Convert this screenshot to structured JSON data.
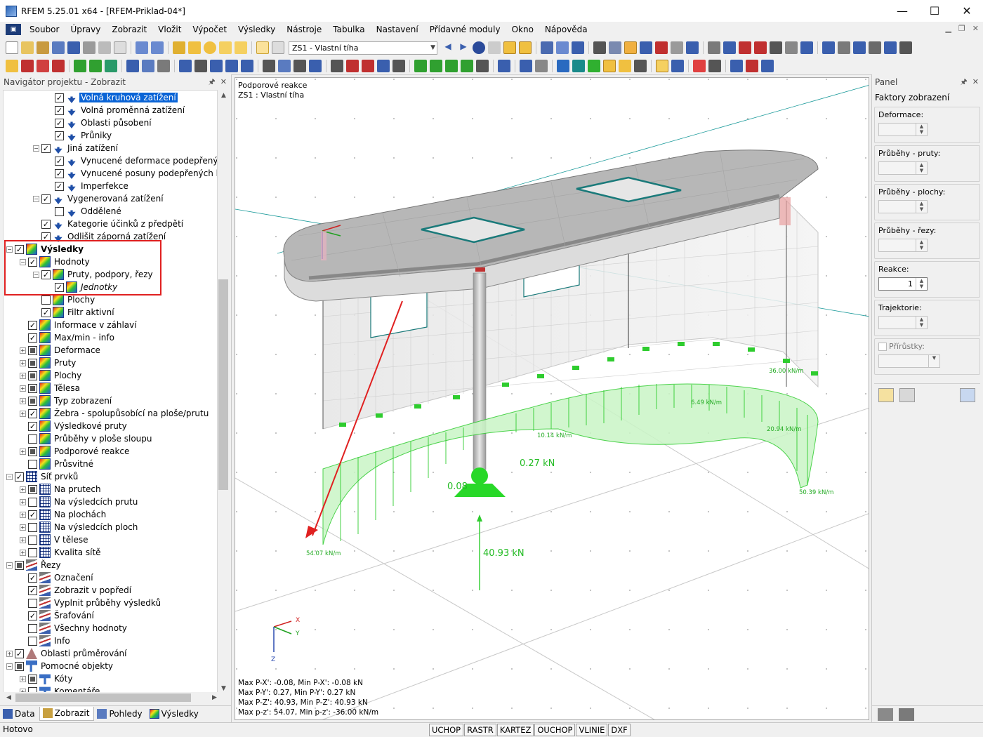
{
  "window": {
    "title": "RFEM 5.25.01 x64 - [RFEM-Priklad-04*]",
    "minimize": "—",
    "maximize": "☐",
    "close": "✕"
  },
  "menu": {
    "items": [
      "Soubor",
      "Úpravy",
      "Zobrazit",
      "Vložit",
      "Výpočet",
      "Výsledky",
      "Nástroje",
      "Tabulka",
      "Nastavení",
      "Přídavné moduly",
      "Okno",
      "Nápověda"
    ]
  },
  "toolbar": {
    "load_case": "ZS1 - Vlastní tíha"
  },
  "navigator": {
    "title": "Navigátor projektu - Zobrazit",
    "tree": [
      {
        "label": "Volná kruhová zatížení",
        "checked": true,
        "icon": "load",
        "selected": true
      },
      {
        "label": "Volná proměnná zatížení",
        "checked": true,
        "icon": "load"
      },
      {
        "label": "Oblasti působení",
        "checked": true,
        "icon": "load"
      },
      {
        "label": "Průniky",
        "checked": true,
        "icon": "load"
      },
      {
        "label": "Jiná zatížení",
        "checked": true,
        "icon": "load"
      },
      {
        "label": "Vynucené deformace podepřených uzlů",
        "checked": true,
        "icon": "load"
      },
      {
        "label": "Vynucené posuny podepřených linií",
        "checked": true,
        "icon": "load"
      },
      {
        "label": "Imperfekce",
        "checked": true,
        "icon": "load"
      },
      {
        "label": "Vygenerovaná zatížení",
        "checked": true,
        "icon": "load"
      },
      {
        "label": "Oddělené",
        "checked": false,
        "icon": "load"
      },
      {
        "label": "Kategorie účinků z předpětí",
        "checked": true,
        "icon": "load"
      },
      {
        "label": "Odlišit záporná zatížení",
        "checked": true,
        "icon": "load"
      },
      {
        "label": "Výsledky",
        "checked": true,
        "icon": "res"
      },
      {
        "label": "Hodnoty",
        "checked": true,
        "icon": "res"
      },
      {
        "label": "Pruty, podpory, řezy",
        "checked": true,
        "icon": "res"
      },
      {
        "label": "Jednotky",
        "checked": true,
        "icon": "res"
      },
      {
        "label": "Plochy",
        "checked": false,
        "icon": "res"
      },
      {
        "label": "Filtr aktivní",
        "checked": true,
        "icon": "res"
      },
      {
        "label": "Informace v záhlaví",
        "checked": true,
        "icon": "res"
      },
      {
        "label": "Max/min - info",
        "checked": true,
        "icon": "res"
      },
      {
        "label": "Deformace",
        "checked": "partial",
        "icon": "res"
      },
      {
        "label": "Pruty",
        "checked": "partial",
        "icon": "res"
      },
      {
        "label": "Plochy",
        "checked": "partial",
        "icon": "res"
      },
      {
        "label": "Tělesa",
        "checked": "partial",
        "icon": "res"
      },
      {
        "label": "Typ zobrazení",
        "checked": "partial",
        "icon": "res"
      },
      {
        "label": "Žebra - spolupůsobící na ploše/prutu",
        "checked": true,
        "icon": "res"
      },
      {
        "label": "Výsledkové pruty",
        "checked": true,
        "icon": "res"
      },
      {
        "label": "Průběhy v ploše sloupu",
        "checked": false,
        "icon": "res"
      },
      {
        "label": "Podporové reakce",
        "checked": "partial",
        "icon": "res"
      },
      {
        "label": "Průsvitné",
        "checked": false,
        "icon": "res"
      },
      {
        "label": "Síť prvků",
        "checked": true,
        "icon": "mesh"
      },
      {
        "label": "Na prutech",
        "checked": "partial",
        "icon": "mesh"
      },
      {
        "label": "Na výsledcích prutu",
        "checked": false,
        "icon": "mesh"
      },
      {
        "label": "Na plochách",
        "checked": true,
        "icon": "mesh"
      },
      {
        "label": "Na výsledcích ploch",
        "checked": false,
        "icon": "mesh"
      },
      {
        "label": "V tělese",
        "checked": false,
        "icon": "mesh"
      },
      {
        "label": "Kvalita sítě",
        "checked": false,
        "icon": "mesh"
      },
      {
        "label": "Řezy",
        "checked": "partial",
        "icon": "section"
      },
      {
        "label": "Označení",
        "checked": true,
        "icon": "section"
      },
      {
        "label": "Zobrazit v popředí",
        "checked": true,
        "icon": "section"
      },
      {
        "label": "Vyplnit průběhy výsledků",
        "checked": false,
        "icon": "section"
      },
      {
        "label": "Šrafování",
        "checked": true,
        "icon": "section"
      },
      {
        "label": "Všechny hodnoty",
        "checked": false,
        "icon": "section"
      },
      {
        "label": "Info",
        "checked": false,
        "icon": "section"
      },
      {
        "label": "Oblasti průměrování",
        "checked": true,
        "icon": "avg"
      },
      {
        "label": "Pomocné objekty",
        "checked": "partial",
        "icon": "guide"
      },
      {
        "label": "Kóty",
        "checked": "partial",
        "icon": "dim"
      },
      {
        "label": "Komentáře",
        "checked": false,
        "icon": "dim"
      }
    ],
    "tabs": [
      "Data",
      "Zobrazit",
      "Pohledy",
      "Výsledky"
    ]
  },
  "viewport": {
    "info_line1": "Podporové reakce",
    "info_line2": "ZS1 : Vlastní tíha",
    "maxmin": [
      "Max P-X': -0.08, Min P-X': -0.08 kN",
      "Max P-Y': 0.27, Min P-Y': 0.27 kN",
      "Max P-Z': 40.93, Min P-Z': 40.93 kN",
      "Max p-z': 54.07, Min p-z': -36.00 kN/m"
    ],
    "labels": {
      "v1": "36.00 kN/m",
      "v2": "6.49 kN/m",
      "v3": "20.94 kN/m",
      "v4": "10.14 kN/m",
      "v5": "0.27 kN",
      "v6": "0.08",
      "v7": "50.39 kN/m",
      "v8": "54.07 kN/m",
      "v9": "40.93 kN"
    },
    "axes": {
      "x": "X",
      "y": "Y",
      "z": "Z"
    }
  },
  "panel": {
    "title": "Panel",
    "section_title": "Faktory zobrazení",
    "groups": [
      {
        "label": "Deformace:",
        "value": ""
      },
      {
        "label": "Průběhy - pruty:",
        "value": ""
      },
      {
        "label": "Průběhy - plochy:",
        "value": ""
      },
      {
        "label": "Průběhy - řezy:",
        "value": ""
      },
      {
        "label": "Reakce:",
        "value": "1"
      },
      {
        "label": "Trajektorie:",
        "value": ""
      }
    ],
    "increments_label": "Přírůstky:"
  },
  "status": {
    "text": "Hotovo",
    "toggles": [
      "UCHOP",
      "RASTR",
      "KARTEZ",
      "OUCHOP",
      "VLINIE",
      "DXF"
    ]
  },
  "colors": {
    "accent_selection": "#0a64d6",
    "annotation_red": "#e02020",
    "reaction_green": "#22dd22"
  }
}
